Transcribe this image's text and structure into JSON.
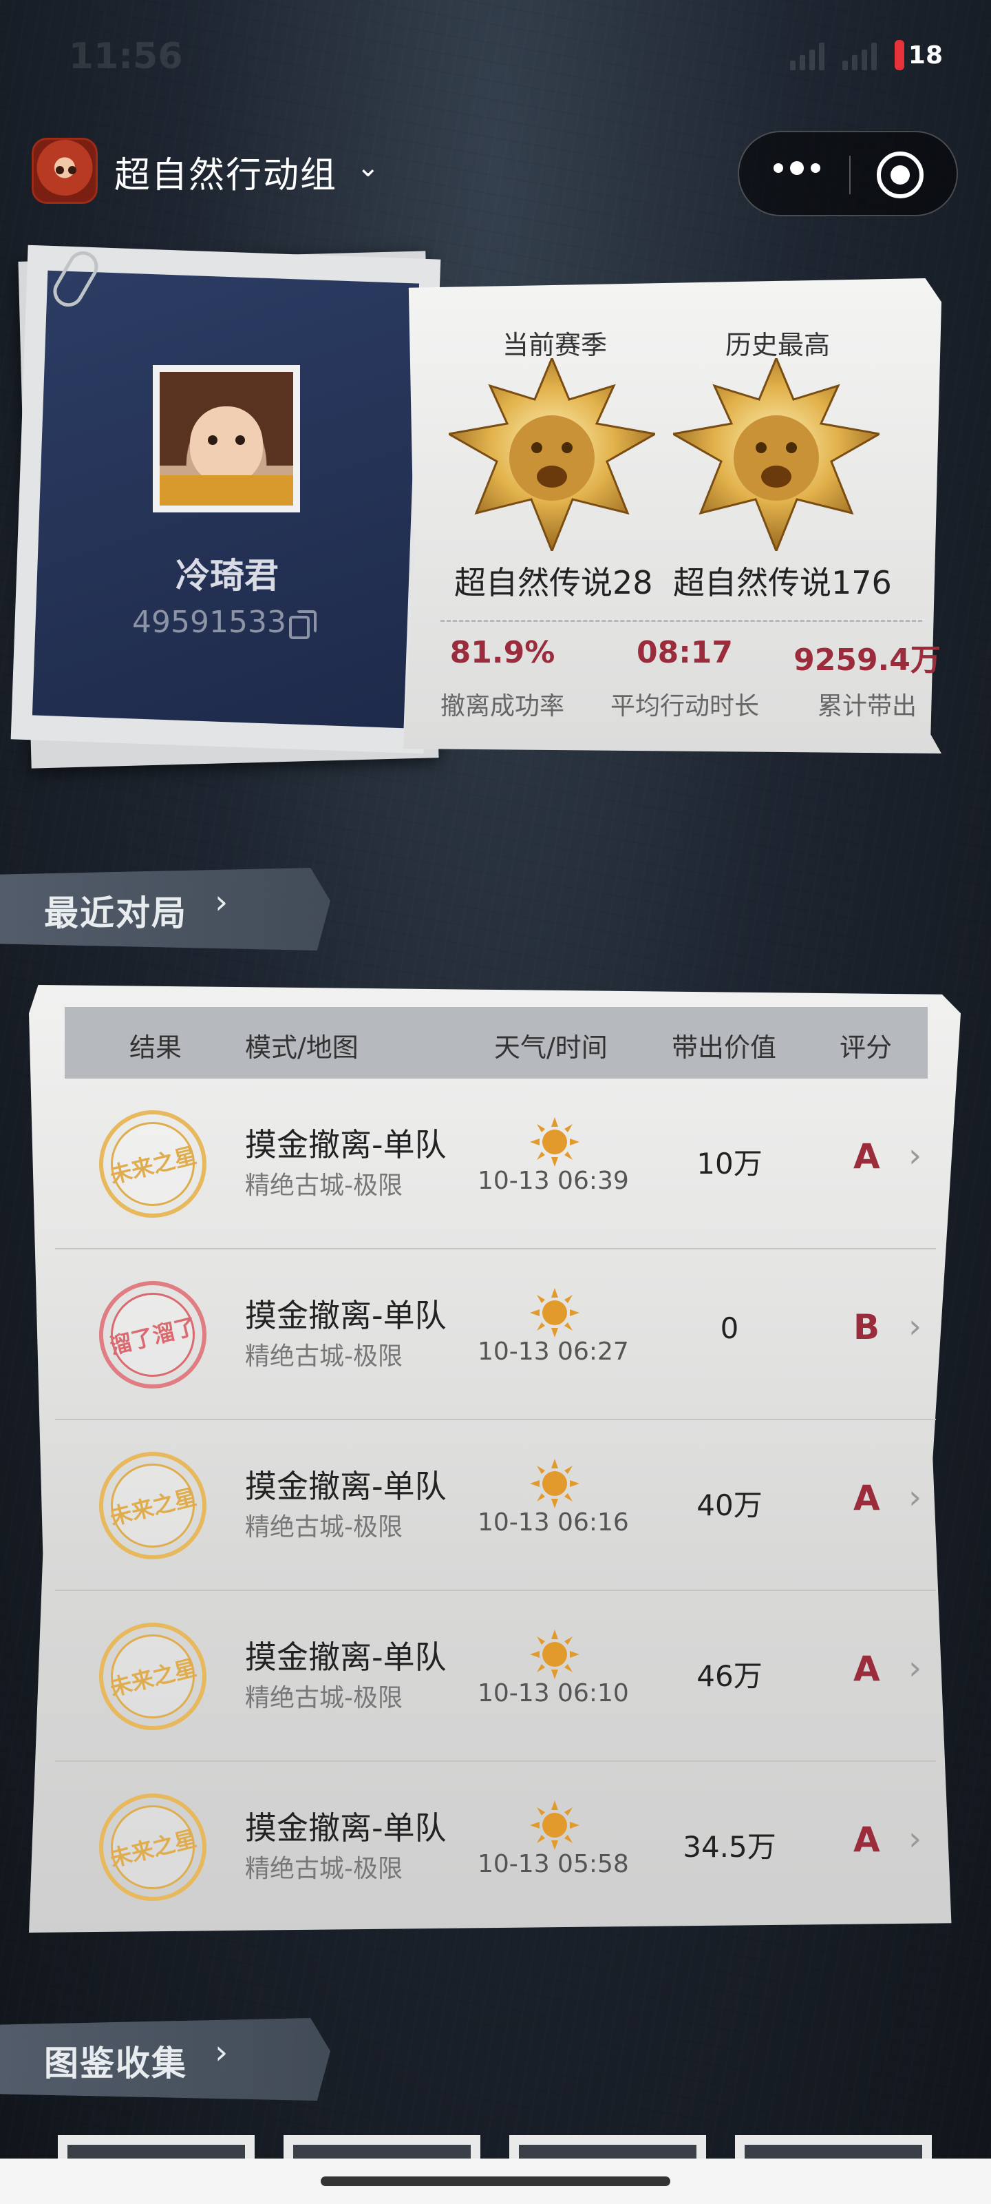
{
  "status_bar": {
    "time": "11:56",
    "battery": "18"
  },
  "header": {
    "title": "超自然行动组",
    "dropdown_icon": "chevron-down-icon",
    "menu_icon": "more-icon",
    "close_icon": "target-icon"
  },
  "profile": {
    "nickname": "冷琦君",
    "uid": "49591533"
  },
  "ranks": {
    "current_label": "当前赛季",
    "history_label": "历史最高",
    "current_rank": "超自然传说28",
    "history_rank": "超自然传说176"
  },
  "stats": [
    {
      "value": "81.9%",
      "label": "撤离成功率"
    },
    {
      "value": "08:17",
      "label": "平均行动时长"
    },
    {
      "value": "9259.4万",
      "label": "累计带出"
    }
  ],
  "recent": {
    "title": "最近对局",
    "columns": [
      "结果",
      "模式/地图",
      "天气/时间",
      "带出价值",
      "评分"
    ],
    "rows": [
      {
        "stamp": "未来之星",
        "mode": "摸金撤离-单队",
        "map": "精绝古城-极限",
        "time": "10-13 06:39",
        "value": "10万",
        "grade": "A",
        "stamp_color": "#e0ad4e"
      },
      {
        "stamp": "溜了溜了",
        "mode": "摸金撤离-单队",
        "map": "精绝古城-极限",
        "time": "10-13 06:27",
        "value": "0",
        "grade": "B",
        "stamp_color": "#db6a70"
      },
      {
        "stamp": "未来之星",
        "mode": "摸金撤离-单队",
        "map": "精绝古城-极限",
        "time": "10-13 06:16",
        "value": "40万",
        "grade": "A",
        "stamp_color": "#e0ad4e"
      },
      {
        "stamp": "未来之星",
        "mode": "摸金撤离-单队",
        "map": "精绝古城-极限",
        "time": "10-13 06:10",
        "value": "46万",
        "grade": "A",
        "stamp_color": "#e0ad4e"
      },
      {
        "stamp": "未来之星",
        "mode": "摸金撤离-单队",
        "map": "精绝古城-极限",
        "time": "10-13 05:58",
        "value": "34.5万",
        "grade": "A",
        "stamp_color": "#e0ad4e"
      }
    ]
  },
  "collection": {
    "title": "图鉴收集"
  }
}
